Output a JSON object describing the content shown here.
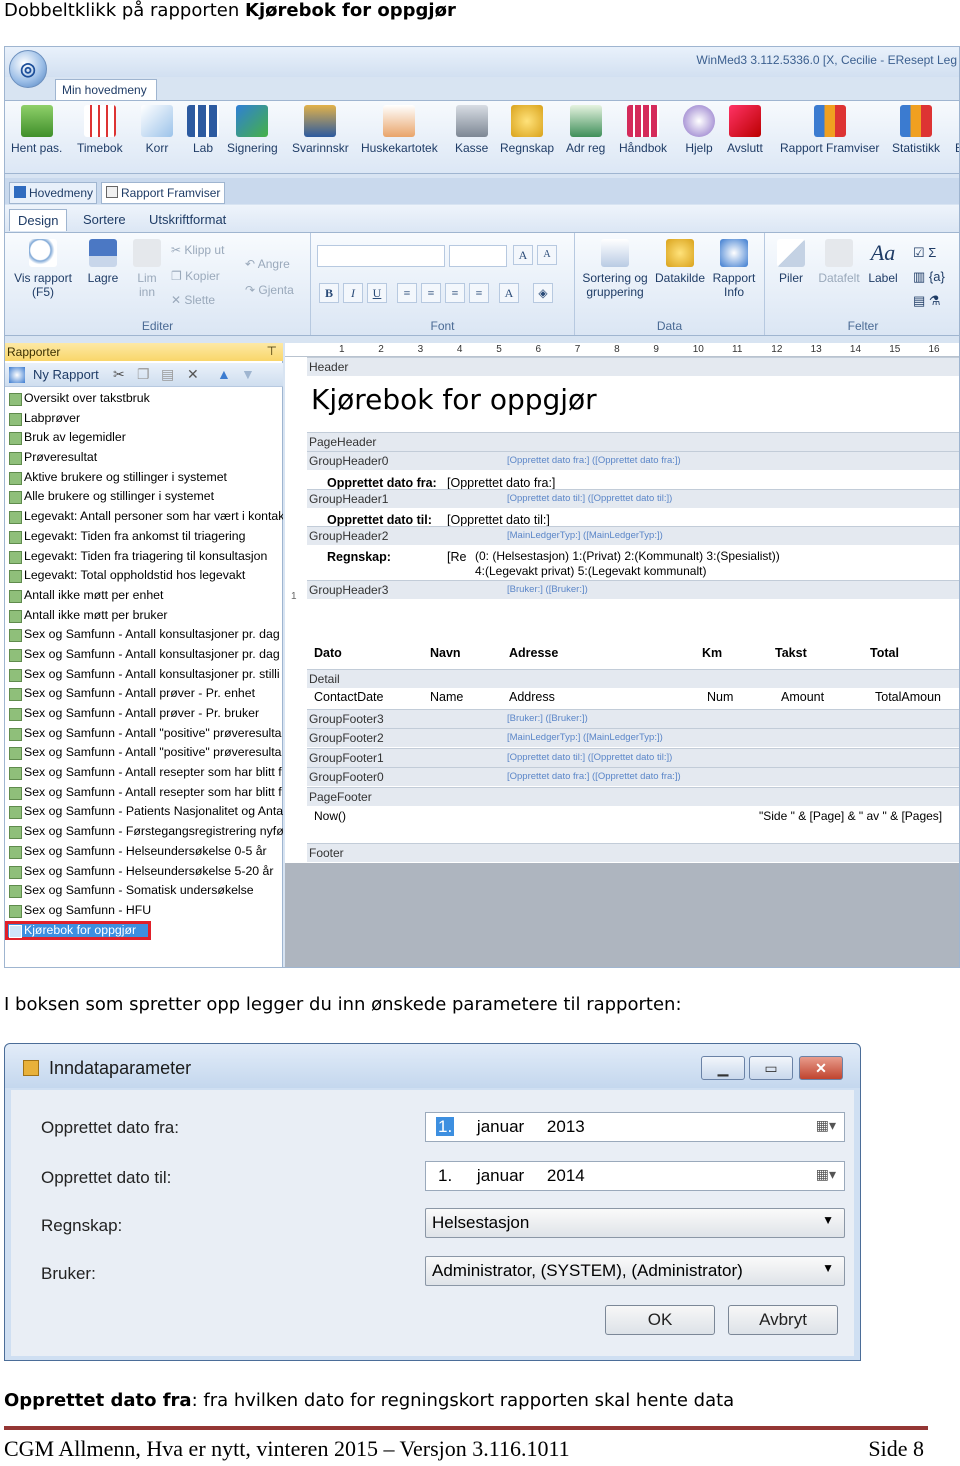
{
  "intro": {
    "prefix": "Dobbeltklikk på rapporten ",
    "bold": "Kjørebok for oppgjør"
  },
  "app": {
    "window_title": "WinMed3 3.112.5336.0 [X, Cecilie - EResept Leg",
    "main_tab": "Min hovedmeny",
    "toolbar": [
      "Hent pas.",
      "Timebok",
      "Korr",
      "Lab",
      "Signering",
      "Svarinnskr",
      "Huskekartotek",
      "Kasse",
      "Regnskap",
      "Adr reg",
      "Håndbok",
      "Hjelp",
      "Avslutt",
      "Rapport Framviser",
      "Statistikk",
      "E"
    ],
    "doc_tabs": [
      "Hovedmeny",
      "Rapport Framviser"
    ],
    "sub_tabs": [
      "Design",
      "Sortere",
      "Utskriftformat"
    ],
    "ribbon": {
      "vis_rapport": "Vis rapport",
      "vis_rapport_key": "(F5)",
      "lagre": "Lagre",
      "lim": "Lim",
      "inn": "inn",
      "klipp_ut": "Klipp ut",
      "kopier": "Kopier",
      "slette": "Slette",
      "angre": "Angre",
      "gjenta": "Gjenta",
      "editer": "Editer",
      "font": "Font",
      "sortering_1": "Sortering og",
      "sortering_2": "gruppering",
      "datakilde": "Datakilde",
      "rapport_info_1": "Rapport",
      "rapport_info_2": "Info",
      "data": "Data",
      "piler": "Piler",
      "datafelt": "Datafelt",
      "label": "Label",
      "felter": "Felter"
    },
    "reports_panel": {
      "title": "Rapporter",
      "new_report": "Ny Rapport",
      "items": [
        "Oversikt over takstbruk",
        "Labprøver",
        "Bruk av legemidler",
        "Prøveresultat",
        "Aktive brukere og stillinger i systemet",
        "Alle brukere og stillinger i systemet",
        "Legevakt: Antall personer som har vært i kontak",
        "Legevakt: Tiden fra ankomst til triagering",
        "Legevakt: Tiden fra triagering til konsultasjon",
        "Legevakt: Total oppholdstid hos legevakt",
        "Antall ikke møtt per enhet",
        "Antall ikke møtt per bruker",
        "Sex og Samfunn - Antall konsultasjoner pr. dag",
        "Sex og Samfunn - Antall konsultasjoner pr. dag",
        "Sex og Samfunn - Antall konsultasjoner pr. stilli",
        "Sex og Samfunn - Antall prøver - Pr. enhet",
        "Sex og Samfunn - Antall prøver - Pr. bruker",
        "Sex og Samfunn - Antall \"positive\" prøveresulta",
        "Sex og Samfunn - Antall \"positive\" prøveresulta",
        "Sex og Samfunn - Antall resepter som har blitt f",
        "Sex og Samfunn - Antall resepter som har blitt f",
        "Sex og Samfunn - Patients Nasjonalitet og Anta",
        "Sex og Samfunn - Førstegangsregistrering nyfø",
        "Sex og Samfunn - Helseundersøkelse 0-5 år",
        "Sex og Samfunn - Helseundersøkelse 5-20 år",
        "Sex og Samfunn - Somatisk undersøkelse",
        "Sex og Samfunn - HFU",
        "Kjørebok for oppgjør"
      ],
      "selected": "Kjørebok for oppgjør"
    },
    "designer": {
      "ruler": [
        "1",
        "2",
        "3",
        "4",
        "5",
        "6",
        "7",
        "8",
        "9",
        "10",
        "11",
        "12",
        "13",
        "14",
        "15",
        "16"
      ],
      "header": "Header",
      "report_title": "Kjørebok for oppgjør",
      "page_header": "PageHeader",
      "gh0": "GroupHeader0",
      "gh0_field": "[Opprettet dato fra:] ([Opprettet dato fra:])",
      "fra_label": "Opprettet dato fra:",
      "fra_value": "[Opprettet dato fra:]",
      "gh1": "GroupHeader1",
      "gh1_field": "[Opprettet dato til:] ([Opprettet dato til:])",
      "til_label": "Opprettet dato til:",
      "til_value": "[Opprettet dato til:]",
      "gh2": "GroupHeader2",
      "gh2_field": "[MainLedgerTyp:] ([MainLedgerTyp:])",
      "regnskap_label": "Regnskap:",
      "regnskap_re": "[Re",
      "regnskap_opts_1": "(0: (Helsestasjon) 1:(Privat) 2:(Kommunalt) 3:(Spesialist))",
      "regnskap_opts_2": "4:(Legevakt privat) 5:(Legevakt kommunalt)",
      "gh3": "GroupHeader3",
      "gh3_field": "[Bruker:] ([Bruker:])",
      "col_dato": "Dato",
      "col_navn": "Navn",
      "col_adresse": "Adresse",
      "col_km": "Km",
      "col_takst": "Takst",
      "col_total": "Total",
      "detail": "Detail",
      "f_contactdate": "ContactDate",
      "f_name": "Name",
      "f_address": "Address",
      "f_num": "Num",
      "f_amount": "Amount",
      "f_totalamount": "TotalAmoun",
      "gf3": "GroupFooter3",
      "gf3_field": "[Bruker:] ([Bruker:])",
      "gf2": "GroupFooter2",
      "gf2_field": "[MainLedgerTyp:] ([MainLedgerTyp:])",
      "gf1": "GroupFooter1",
      "gf1_field": "[Opprettet dato til:] ([Opprettet dato til:])",
      "gf0": "GroupFooter0",
      "gf0_field": "[Opprettet dato fra:] ([Opprettet dato fra:])",
      "page_footer": "PageFooter",
      "now": "Now()",
      "side_expr": "\"Side \" & [Page] & \" av \" & [Pages]",
      "footer": "Footer",
      "margin_marker": "1"
    }
  },
  "para2": "I boksen som spretter opp legger du inn ønskede parametere til rapporten:",
  "dialog": {
    "title": "Inndataparameter",
    "labels": {
      "fra": "Opprettet dato fra:",
      "til": "Opprettet dato til:",
      "regnskap": "Regnskap:",
      "bruker": "Bruker:"
    },
    "fra": {
      "day": "1.",
      "month": "januar",
      "year": "2013"
    },
    "til": {
      "day": "1.",
      "month": "januar",
      "year": "2014"
    },
    "regnskap_value": "Helsestasjon",
    "bruker_value": "Administrator, (SYSTEM), (Administrator)",
    "ok": "OK",
    "cancel": "Avbryt"
  },
  "para3": {
    "bold": "Opprettet dato fra",
    "rest": ": fra hvilken dato for regningskort rapporten skal hente data"
  },
  "footer": {
    "text": "CGM Allmenn, Hva er nytt, vinteren 2015 – Versjon 3.116.1011",
    "page": "Side 8"
  },
  "colors": {
    "ribbon": "#dce7f5",
    "selection": "#3d8fe0",
    "highlight_box": "#e0202a",
    "footer_rule": "#943634"
  }
}
